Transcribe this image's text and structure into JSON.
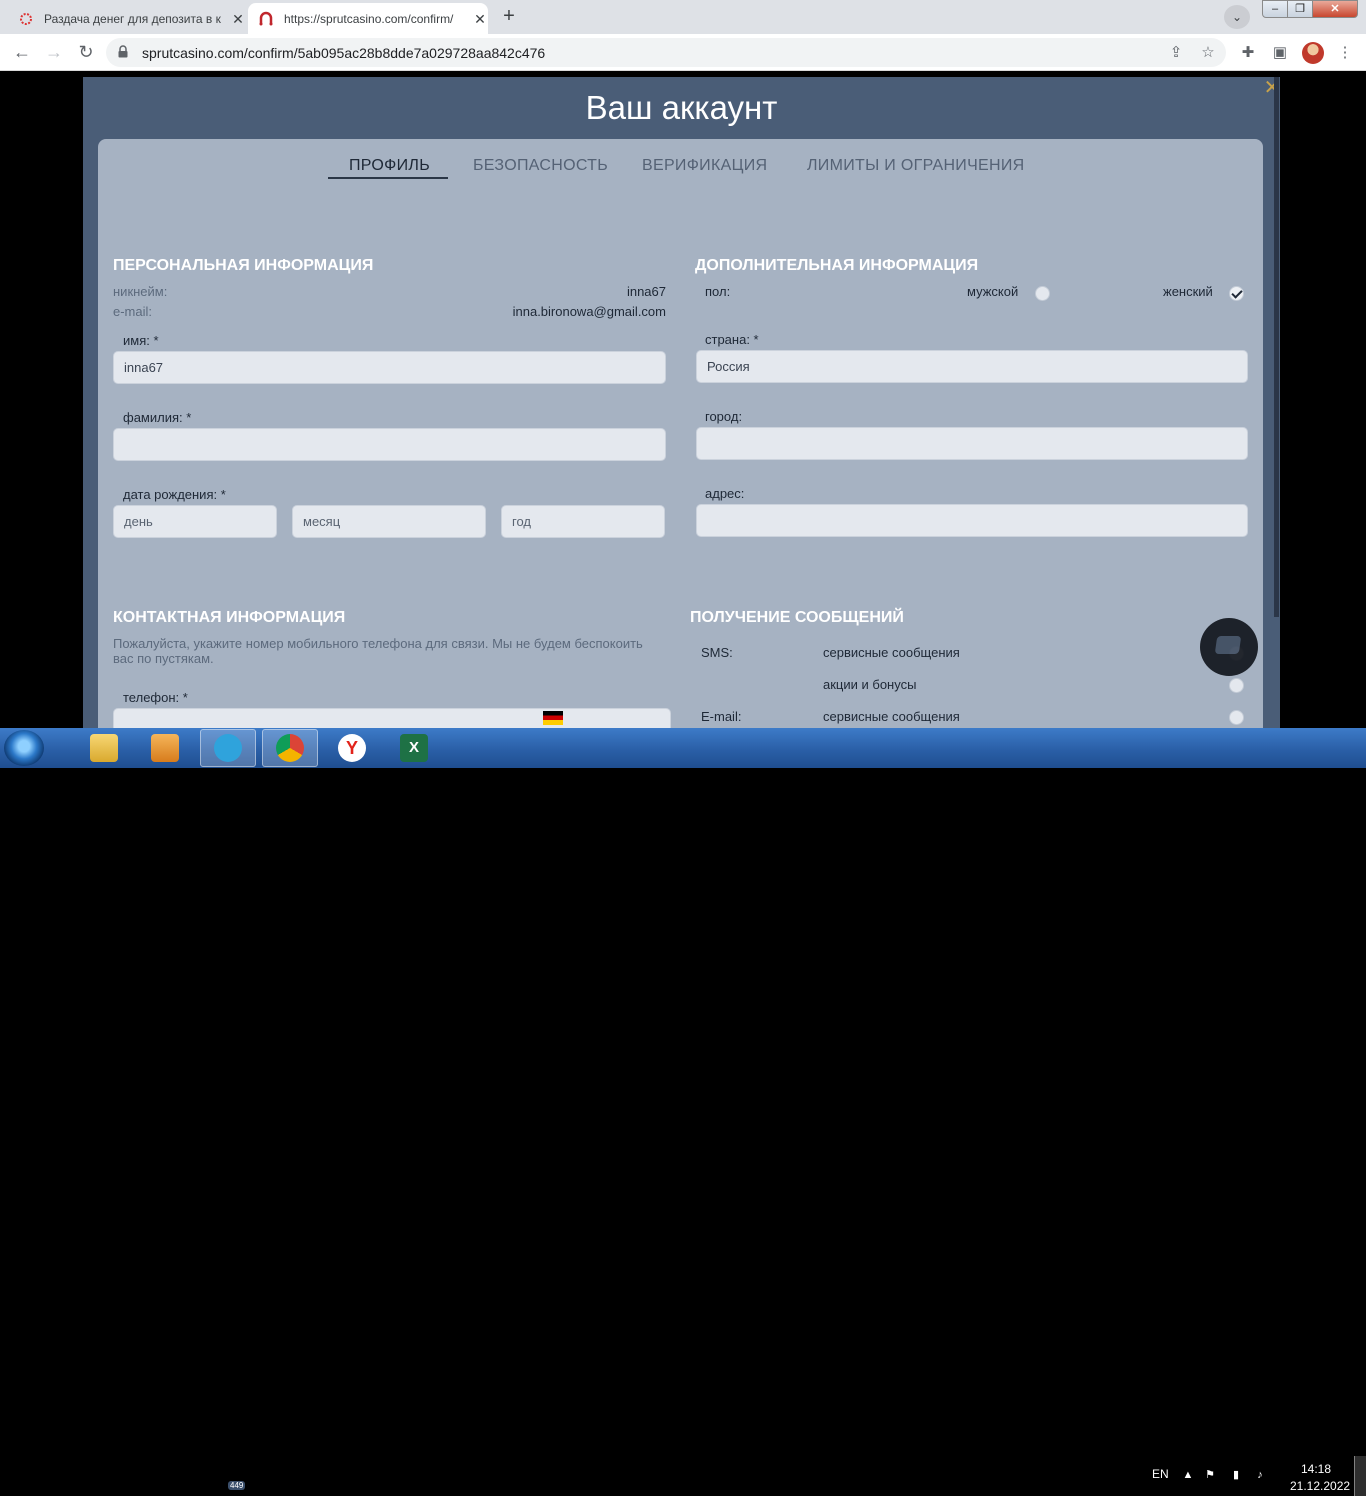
{
  "browser": {
    "tabs": [
      {
        "title": "Раздача денег для депозита в к",
        "active": false
      },
      {
        "title": "https://sprutcasino.com/confirm/",
        "active": true
      }
    ],
    "new_tab": "+",
    "url": "sprutcasino.com/confirm/5ab095ac28b8dde7a029728aa842c476"
  },
  "modal": {
    "title": "Ваш аккаунт",
    "tabs": [
      "ПРОФИЛЬ",
      "БЕЗОПАСНОСТЬ",
      "ВЕРИФИКАЦИЯ",
      "ЛИМИТЫ И ОГРАНИЧЕНИЯ"
    ],
    "active_tab": "ПРОФИЛЬ",
    "personal": {
      "title": "ПЕРСОНАЛЬНАЯ ИНФОРМАЦИЯ",
      "nickname_label": "никнейм:",
      "nickname_value": "inna67",
      "email_label": "e-mail:",
      "email_value": "inna.bironowa@gmail.com",
      "first_name_label": "имя: *",
      "first_name_value": "inna67",
      "last_name_label": "фамилия: *",
      "last_name_value": "",
      "birth_label": "дата рождения: *",
      "day_placeholder": "день",
      "month_placeholder": "месяц",
      "year_placeholder": "год"
    },
    "additional": {
      "title": "ДОПОЛНИТЕЛЬНАЯ ИНФОРМАЦИЯ",
      "gender_label": "пол:",
      "male_label": "мужской",
      "female_label": "женский",
      "selected_gender": "женский",
      "country_label": "страна: *",
      "country_value": "Россия",
      "city_label": "город:",
      "address_label": "адрес:"
    },
    "contact": {
      "title": "КОНТАКТНАЯ ИНФОРМАЦИЯ",
      "hint": "Пожалуйста, укажите номер мобильного телефона для связи. Мы не будем беспокоить вас по пустякам.",
      "phone_label": "телефон: *"
    },
    "messages": {
      "title": "ПОЛУЧЕНИЕ СООБЩЕНИЙ",
      "sms_label": "SMS:",
      "email_label": "E-mail:",
      "service_label": "сервисные сообщения",
      "promo_label": "акции и бонусы"
    }
  },
  "taskbar": {
    "telegram_badge": "449",
    "language": "EN",
    "time": "14:18",
    "date": "21.12.2022"
  },
  "colors": {
    "modal_bg": "#4a5d77",
    "panel_bg": "#a6b2c2",
    "field_bg": "#e4e8ee",
    "close_accent": "#c8a24a"
  }
}
